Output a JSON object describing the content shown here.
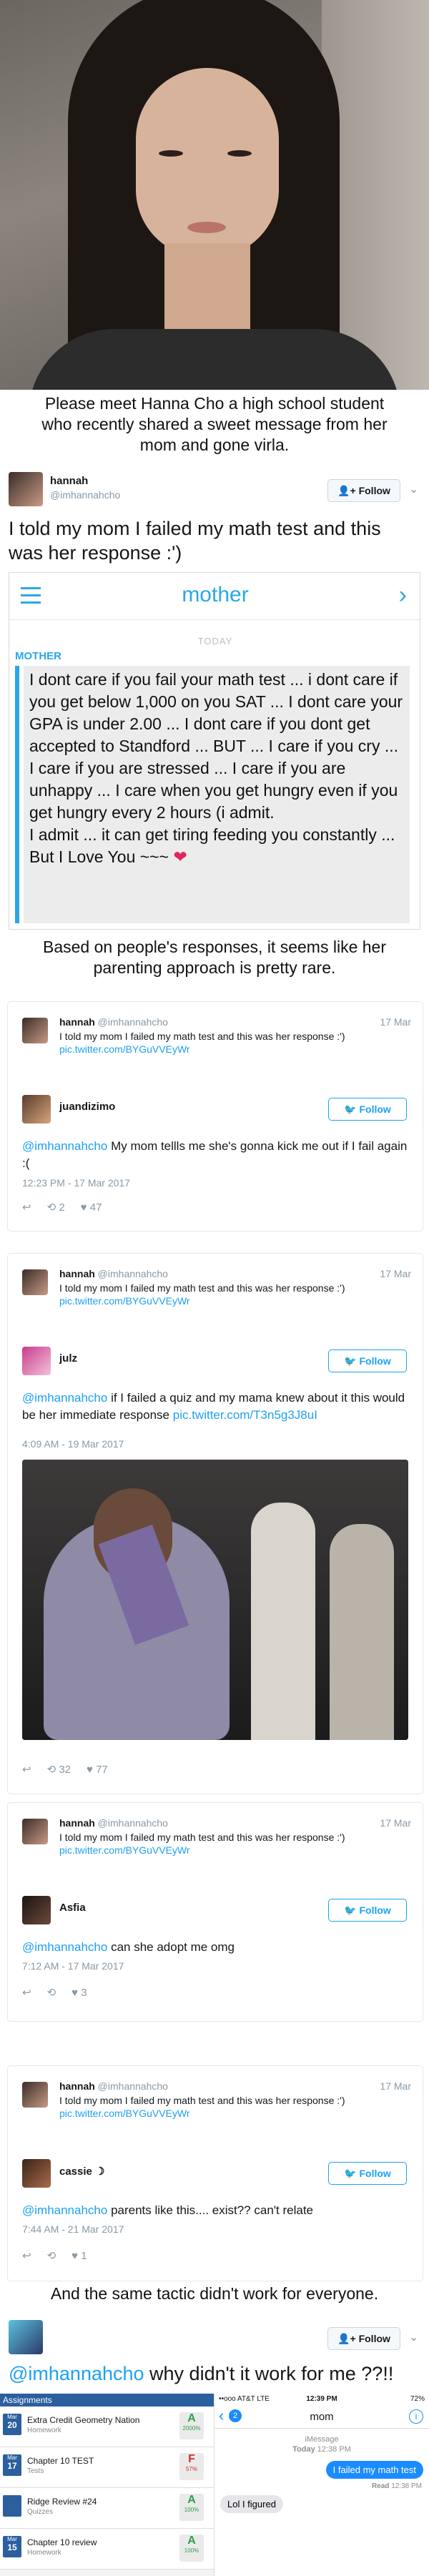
{
  "intro_caption": "Please meet Hanna Cho a high school student who recently shared a sweet message from her mom and gone virla.",
  "main_tweet": {
    "name": "hannah",
    "handle": "@imhannahcho",
    "follow_label": "Follow",
    "text": "I told my mom I failed my math test and this was her response :')"
  },
  "message": {
    "title": "mother",
    "day": "TODAY",
    "sender": "MOTHER",
    "body": "I dont care if you fail your math test ... i dont care if you get below 1,000 on you SAT ... I dont care your GPA is under 2.00 ... I dont care if you dont get accepted to Standford ... BUT ... I care if you cry ... I care if you are stressed ... I care if you are unhappy ... I care when you get hungry even if you get hungry every 2 hours  (i admit.",
    "body2": "I admit ... it can get tiring feeding you constantly  ... But I Love You ~~~ ",
    "heart": "❤"
  },
  "mid_caption": "Based on people's responses, it seems like her parenting approach is pretty rare.",
  "quoted": {
    "name": "hannah",
    "handle": "@imhannahcho",
    "date": "17 Mar",
    "text": "I told my mom I failed my math test and this was her response :')",
    "link": "pic.twitter.com/BYGuVVEyWr"
  },
  "replies": [
    {
      "name": "juandizimo",
      "mention": "@imhannahcho",
      "text": " My mom tellls me she's gonna kick me out if I fail again :(",
      "link": "",
      "time": "12:23 PM - 17 Mar 2017",
      "retweets": "2",
      "likes": "47",
      "follow_label": "Follow"
    },
    {
      "name": "julz",
      "mention": "@imhannahcho",
      "text": " if I failed a quiz and my mama knew about it this would be her immediate response ",
      "link": "pic.twitter.com/T3n5g3J8uI",
      "time": "4:09 AM - 19 Mar 2017",
      "retweets": "32",
      "likes": "77",
      "follow_label": "Follow"
    },
    {
      "name": "Asfia",
      "mention": "@imhannahcho",
      "text": " can she adopt me omg",
      "link": "",
      "time": "7:12 AM - 17 Mar 2017",
      "retweets": "",
      "likes": "3",
      "follow_label": "Follow"
    },
    {
      "name": "cassie ☽",
      "mention": "@imhannahcho",
      "text": " parents like this.... exist?? can't relate",
      "link": "",
      "time": "7:44 AM - 21 Mar 2017",
      "retweets": "",
      "likes": "1",
      "follow_label": "Follow"
    }
  ],
  "end_caption": "And the same tactic didn't work for everyone.",
  "final_tweet": {
    "follow_label": "Follow",
    "mention": "@imhannahcho",
    "text": " why didn't it work for me ??!!"
  },
  "grades": {
    "header": "Assignments",
    "rows": [
      {
        "month": "Mar",
        "day": "20",
        "title": "Extra Credit Geometry Nation",
        "type": "Homework",
        "grade": "A",
        "pct": "2000%",
        "color": "#2e9e4f"
      },
      {
        "month": "Mar",
        "day": "17",
        "title": "Chapter 10 TEST",
        "type": "Tests",
        "grade": "F",
        "pct": "57%",
        "color": "#d0312d"
      },
      {
        "month": "",
        "day": "",
        "title": "Ridge Review #24",
        "type": "Quizzes",
        "grade": "A",
        "pct": "100%",
        "color": "#2e9e4f"
      },
      {
        "month": "Mar",
        "day": "15",
        "title": "Chapter 10 review",
        "type": "Homework",
        "grade": "A",
        "pct": "100%",
        "color": "#2e9e4f"
      }
    ]
  },
  "phone": {
    "carrier": "••ooo AT&T  LTE",
    "time": "12:39 PM",
    "battery": "72%",
    "back_count": "2",
    "contact": "mom",
    "service": "iMessage",
    "timestamp_day": "Today",
    "timestamp_time": "12:38 PM",
    "sent": "I failed my math test",
    "read_label": "Read",
    "read_time": "12:38 PM",
    "received": "Lol I figured"
  },
  "colors": {
    "twitter_blue": "#1da1f2",
    "message_blue": "#2aa8e6",
    "imessage_blue": "#1a8cff"
  }
}
